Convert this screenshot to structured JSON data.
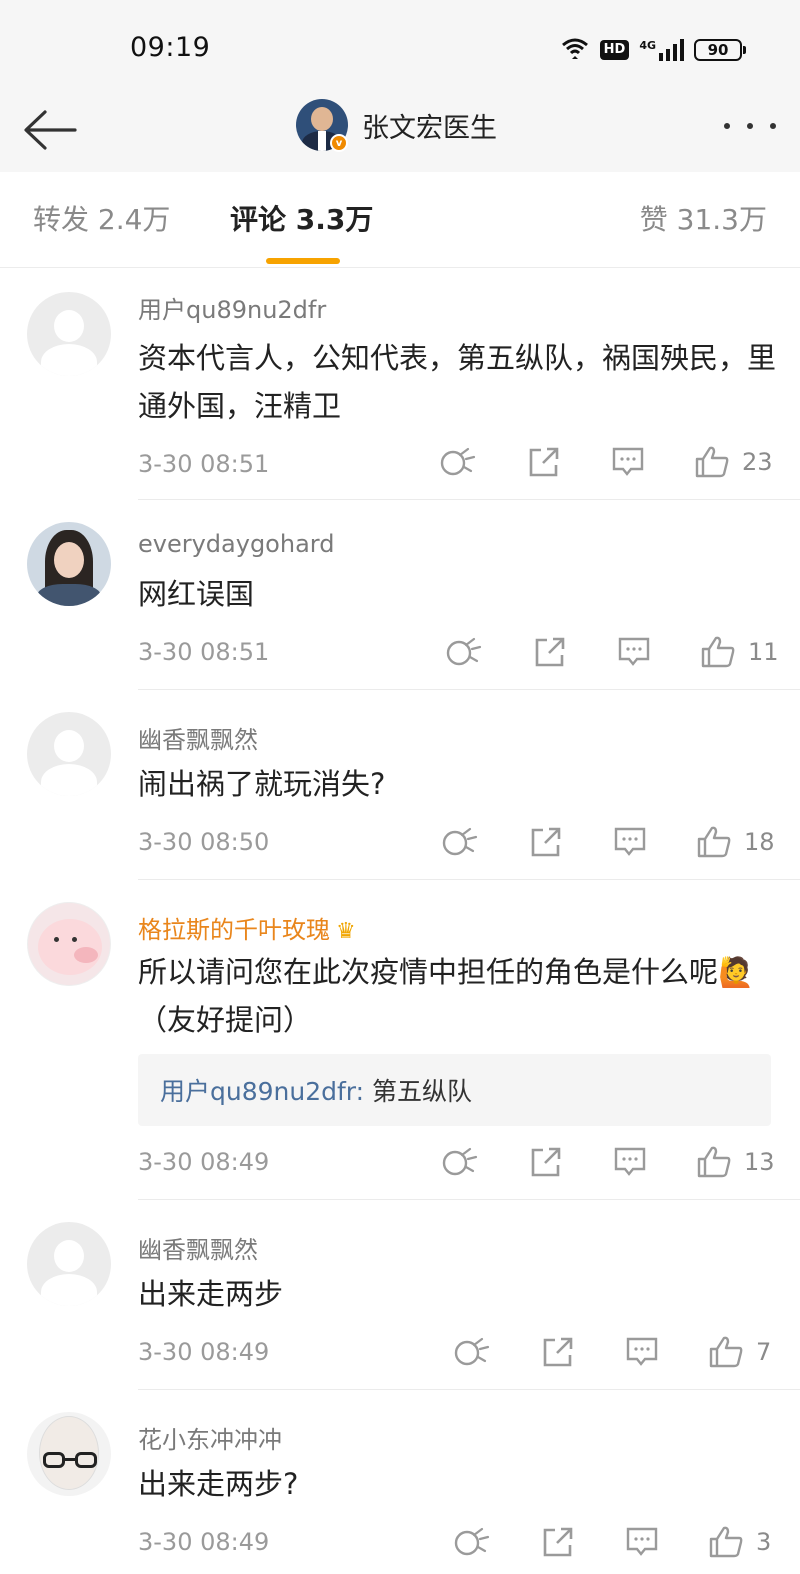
{
  "status_bar": {
    "time": "09:19",
    "hd": "HD",
    "network": "4G",
    "battery": "90"
  },
  "nav": {
    "title": "张文宏医生",
    "verified_badge": "v"
  },
  "tabs": [
    {
      "label": "转发 2.4万"
    },
    {
      "label": "评论 3.3万"
    },
    {
      "label": "赞 31.3万"
    }
  ],
  "comments": [
    {
      "user": "用户qu89nu2dfr",
      "content": "资本代言人，公知代表，第五纵队，祸国殃民，里通外国，汪精卫",
      "time": "3-30 08:51",
      "likes": "23"
    },
    {
      "user": "everydaygohard",
      "content": "网红误国",
      "time": "3-30 08:51",
      "likes": "11"
    },
    {
      "user": "幽香飘飘然",
      "content": "闹出祸了就玩消失?",
      "time": "3-30 08:50",
      "likes": "18"
    },
    {
      "user": "格拉斯的千叶玫瑰",
      "content": "所以请问您在此次疫情中担任的角色是什么呢🙋（友好提问）",
      "reply_user": "用户qu89nu2dfr:",
      "reply_text": " 第五纵队",
      "time": "3-30 08:49",
      "likes": "13"
    },
    {
      "user": "幽香飘飘然",
      "content": "出来走两步",
      "time": "3-30 08:49",
      "likes": "7"
    },
    {
      "user": "花小东冲冲冲",
      "content": "出来走两步?",
      "time": "3-30 08:49",
      "likes": "3"
    }
  ]
}
